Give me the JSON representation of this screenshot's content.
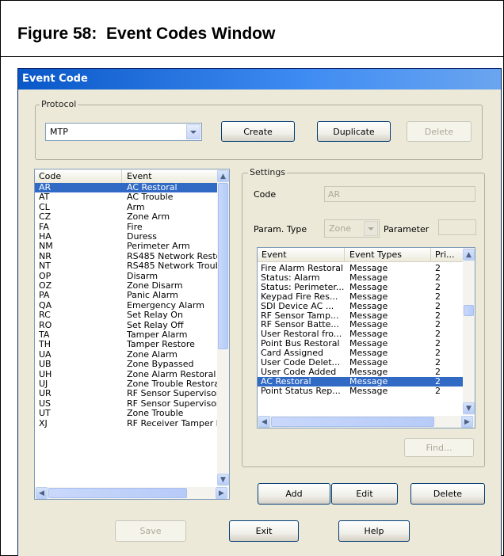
{
  "figure": {
    "title": "Figure 58:  Event Codes Window"
  },
  "window": {
    "title": "Event Code"
  },
  "protocol": {
    "group_label": "Protocol",
    "selected": "MTP",
    "create_label": "Create",
    "duplicate_label": "Duplicate",
    "delete_label": "Delete"
  },
  "codes": {
    "columns": [
      "Code",
      "Event"
    ],
    "rows": [
      {
        "code": "AR",
        "event": "AC Restoral",
        "selected": true
      },
      {
        "code": "AT",
        "event": "AC Trouble"
      },
      {
        "code": "CL",
        "event": "Arm"
      },
      {
        "code": "CZ",
        "event": "Zone Arm"
      },
      {
        "code": "FA",
        "event": "Fire"
      },
      {
        "code": "HA",
        "event": "Duress"
      },
      {
        "code": "NM",
        "event": "Perimeter Arm"
      },
      {
        "code": "NR",
        "event": "RS485 Network Resto"
      },
      {
        "code": "NT",
        "event": "RS485 Network Troub"
      },
      {
        "code": "OP",
        "event": "Disarm"
      },
      {
        "code": "OZ",
        "event": "Zone Disarm"
      },
      {
        "code": "PA",
        "event": "Panic Alarm"
      },
      {
        "code": "QA",
        "event": "Emergency Alarm"
      },
      {
        "code": "RC",
        "event": "Set Relay On"
      },
      {
        "code": "RO",
        "event": "Set Relay Off"
      },
      {
        "code": "TA",
        "event": "Tamper Alarm"
      },
      {
        "code": "TH",
        "event": "Tamper Restore"
      },
      {
        "code": "UA",
        "event": "Zone Alarm"
      },
      {
        "code": "UB",
        "event": "Zone Bypassed"
      },
      {
        "code": "UH",
        "event": "Zone Alarm Restoral"
      },
      {
        "code": "UJ",
        "event": "Zone Trouble Restora"
      },
      {
        "code": "UR",
        "event": "RF Sensor Supervisor"
      },
      {
        "code": "US",
        "event": "RF Sensor Supervisor"
      },
      {
        "code": "UT",
        "event": "Zone Trouble"
      },
      {
        "code": "XJ",
        "event": "RF Receiver Tamper I"
      }
    ]
  },
  "settings": {
    "group_label": "Settings",
    "code_label": "Code",
    "code_value": "AR",
    "param_type_label": "Param. Type",
    "param_type_value": "Zone",
    "parameter_label": "Parameter",
    "parameter_value": "",
    "find_label": "Find...",
    "events": {
      "columns": [
        "Event",
        "Event Types",
        "Pri..."
      ],
      "rows": [
        {
          "event": "Fire Alarm Restoral",
          "type": "Message",
          "pri": "2"
        },
        {
          "event": "Status: Alarm",
          "type": "Message",
          "pri": "2"
        },
        {
          "event": "Status: Perimeter...",
          "type": "Message",
          "pri": "2"
        },
        {
          "event": "Keypad Fire Res...",
          "type": "Message",
          "pri": "2"
        },
        {
          "event": "SDI Device AC ...",
          "type": "Message",
          "pri": "2"
        },
        {
          "event": "RF Sensor Tamp...",
          "type": "Message",
          "pri": "2"
        },
        {
          "event": "RF Sensor Batte...",
          "type": "Message",
          "pri": "2"
        },
        {
          "event": "User Restoral fro...",
          "type": "Message",
          "pri": "2"
        },
        {
          "event": "Point Bus Restoral",
          "type": "Message",
          "pri": "2"
        },
        {
          "event": "Card Assigned",
          "type": "Message",
          "pri": "2"
        },
        {
          "event": "User Code Delet...",
          "type": "Message",
          "pri": "2"
        },
        {
          "event": "User Code Added",
          "type": "Message",
          "pri": "2"
        },
        {
          "event": "AC Restoral",
          "type": "Message",
          "pri": "2",
          "selected": true
        },
        {
          "event": "Point Status Rep...",
          "type": "Message",
          "pri": "2"
        }
      ]
    }
  },
  "actions": {
    "add_label": "Add",
    "edit_label": "Edit",
    "delete_label": "Delete"
  },
  "footer": {
    "save_label": "Save",
    "exit_label": "Exit",
    "help_label": "Help"
  },
  "colors": {
    "selection": "#316ac5",
    "window_bg": "#ece9d8",
    "titlebar": "#0a58c8"
  }
}
